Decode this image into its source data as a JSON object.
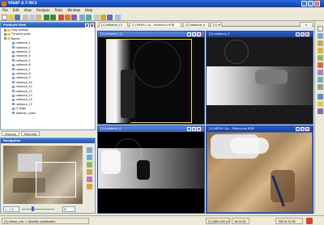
{
  "window": {
    "title": "VISAT 4.7-RC1"
  },
  "menu": [
    "File",
    "Edit",
    "View",
    "Analysis",
    "Tools",
    "Window",
    "Help"
  ],
  "editor_tabs": [
    "[1] radiance_12",
    "[1] MERIS L1b - Tristimulus RGB",
    "[1] radiance_4",
    "[1] ra"
  ],
  "products_panel": {
    "title": "Products View",
    "items": [
      {
        "label": "Flag codings",
        "kind": "folder",
        "level": 1
      },
      {
        "label": "Tie-point grids",
        "kind": "folder",
        "level": 1
      },
      {
        "label": "Bands",
        "kind": "folder",
        "level": 1
      },
      {
        "label": "radiance_1",
        "kind": "band",
        "level": 2
      },
      {
        "label": "radiance_2",
        "kind": "band",
        "level": 2
      },
      {
        "label": "radiance_3",
        "kind": "band",
        "level": 2
      },
      {
        "label": "radiance_4",
        "kind": "band",
        "level": 2
      },
      {
        "label": "radiance_5",
        "kind": "band",
        "level": 2
      },
      {
        "label": "radiance_6",
        "kind": "band",
        "level": 2
      },
      {
        "label": "radiance_7",
        "kind": "band",
        "level": 2
      },
      {
        "label": "radiance_8",
        "kind": "band",
        "level": 2
      },
      {
        "label": "radiance_9",
        "kind": "band",
        "level": 2
      },
      {
        "label": "radiance_10",
        "kind": "band",
        "level": 2
      },
      {
        "label": "radiance_11",
        "kind": "band",
        "level": 2
      },
      {
        "label": "radiance_12",
        "kind": "band",
        "level": 2
      },
      {
        "label": "radiance_13",
        "kind": "band",
        "level": 2
      },
      {
        "label": "radiance_14",
        "kind": "band",
        "level": 2
      },
      {
        "label": "radiance_15",
        "kind": "band",
        "level": 2
      },
      {
        "label": "l1_flags",
        "kind": "band",
        "level": 2
      },
      {
        "label": "detector_index",
        "kind": "band",
        "level": 2
      }
    ]
  },
  "left_tabs": [
    "Products",
    "Pixel Info"
  ],
  "navigation": {
    "title": "Navigation",
    "zoom_value": "1 : 1.9",
    "rotation_value": "0°"
  },
  "image_windows": [
    {
      "title": "[1] radiance_12"
    },
    {
      "title": "[1] radiance_3"
    },
    {
      "title": "[1] radiance_4"
    },
    {
      "title": "[1] MERIS L1b - Tristimulus RGB"
    }
  ],
  "status": {
    "left": "[1] virtual_cntr = Satellite coordinates",
    "coords": "[1] [962,299 (L0)]",
    "time": "16:14:01",
    "memory": "75M of 127M"
  },
  "colors": {
    "accent": "#2458b8",
    "title_bar": "#0a3fb8",
    "highlight": "#f0e020"
  }
}
